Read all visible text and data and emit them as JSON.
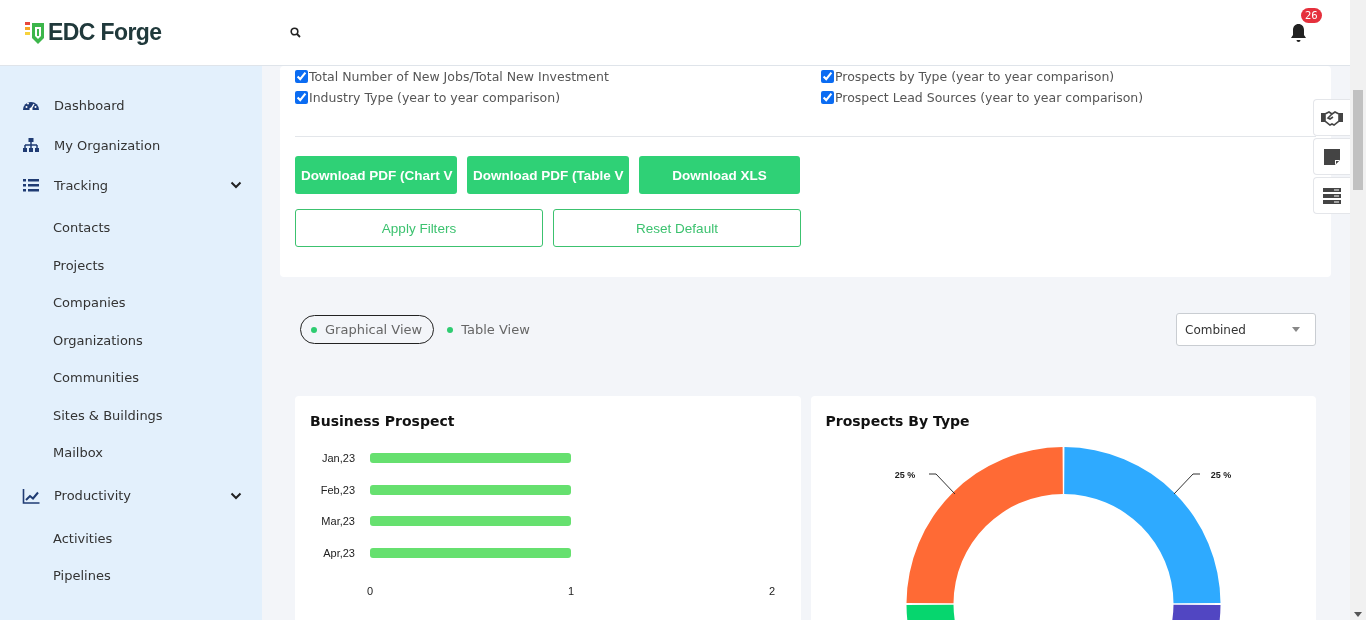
{
  "header": {
    "logo": "EDC Forge",
    "notifications": {
      "count": "26"
    }
  },
  "sidebar": {
    "items": [
      {
        "label": "Dashboard"
      },
      {
        "label": "My Organization"
      },
      {
        "label": "Tracking",
        "expanded": true,
        "children": [
          {
            "label": "Contacts"
          },
          {
            "label": "Projects"
          },
          {
            "label": "Companies"
          },
          {
            "label": "Organizations"
          },
          {
            "label": "Communities"
          },
          {
            "label": "Sites & Buildings"
          },
          {
            "label": "Mailbox"
          }
        ]
      },
      {
        "label": "Productivity",
        "expanded": true,
        "children": [
          {
            "label": "Activities"
          },
          {
            "label": "Pipelines"
          }
        ]
      }
    ]
  },
  "report_options": {
    "checkboxes": [
      {
        "label": "Total Number of New Jobs/Total New Investment",
        "checked": true
      },
      {
        "label": "Prospects by Type (year to year comparison)",
        "checked": true
      },
      {
        "label": "Industry Type (year to year comparison)",
        "checked": true
      },
      {
        "label": "Prospect Lead Sources (year to year comparison)",
        "checked": true
      }
    ],
    "buttons": [
      {
        "label": "Download PDF (Chart V",
        "kind": "primary"
      },
      {
        "label": "Download PDF (Table V",
        "kind": "primary"
      },
      {
        "label": "Download XLS",
        "kind": "primary"
      },
      {
        "label": "Apply Filters",
        "kind": "outline"
      },
      {
        "label": "Reset Default",
        "kind": "outline"
      }
    ]
  },
  "view_toggle": [
    {
      "label": "Graphical View",
      "selected": true
    },
    {
      "label": "Table View",
      "selected": false
    }
  ],
  "view_dropdown": {
    "value": "Combined"
  },
  "charts": [
    {
      "title": "Business Prospect",
      "chart_data": {
        "type": "bar",
        "orientation": "horizontal",
        "categories": [
          "Jan,23",
          "Feb,23",
          "Mar,23",
          "Apr,23"
        ],
        "series": [
          {
            "color": "#66e06f",
            "values": [
              1,
              1,
              1,
              1
            ]
          }
        ],
        "xlim": [
          0,
          2
        ],
        "xticks": [
          0,
          1,
          2
        ]
      }
    },
    {
      "title": "Prospects By Type",
      "chart_data": {
        "type": "donut",
        "values": [
          25,
          25,
          25,
          25
        ],
        "colors": [
          "#2eaaff",
          "#5146c2",
          "#06d66e",
          "#ff6a35"
        ],
        "value_labels": [
          "25 %",
          null,
          null,
          "25 %"
        ]
      }
    }
  ]
}
